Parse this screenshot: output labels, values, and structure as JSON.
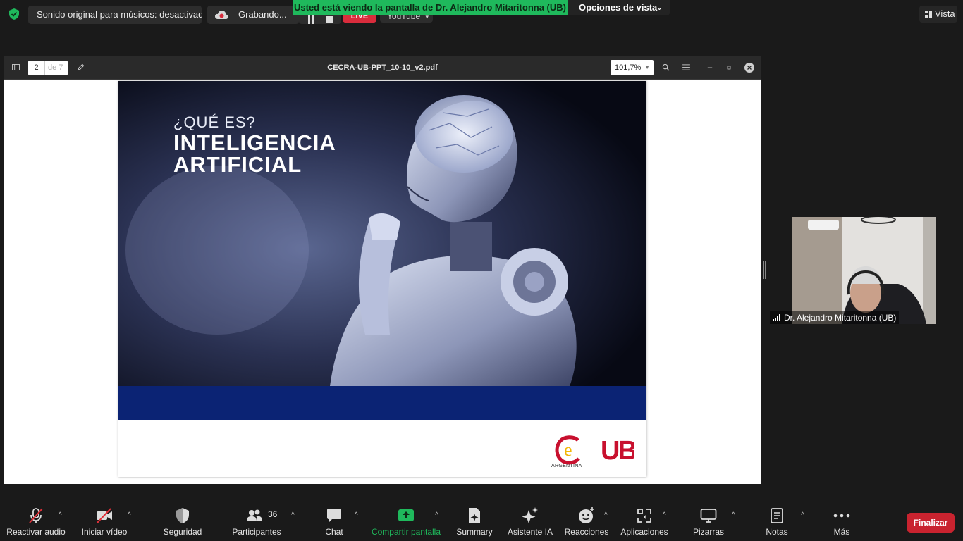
{
  "top_bar": {
    "original_sound": "Sonido original para músicos: desactivado",
    "recording": "Grabando...",
    "live_badge": "LIVE",
    "youtube": "YouTube",
    "share_banner": "Usted está viendo la pantalla de Dr. Alejandro Mitaritonna (UB)",
    "view_options": "Opciones de vista",
    "view_button": "Vista"
  },
  "pdf_viewer": {
    "filename": "CECRA-UB-PPT_10-10_v2.pdf",
    "current_page": "2",
    "total_pages": "de 7",
    "zoom": "101,7%"
  },
  "slide": {
    "subtitle": "¿QUÉ ES?",
    "title_line1": "INTELIGENCIA",
    "title_line2": "ARTIFICIAL",
    "logo_left_caption": "ARGENTINA",
    "logo_right_text": "UB"
  },
  "participant": {
    "name": "Dr. Alejandro Mitaritonna (UB)"
  },
  "toolbar": {
    "unmute": "Reactivar audio",
    "start_video": "Iniciar vídeo",
    "security": "Seguridad",
    "participants": "Participantes",
    "participants_count": "36",
    "chat": "Chat",
    "share_screen": "Compartir pantalla",
    "summary": "Summary",
    "ai_assistant": "Asistente IA",
    "reactions": "Reacciones",
    "apps": "Aplicaciones",
    "whiteboards": "Pizarras",
    "notes": "Notas",
    "more": "Más",
    "end": "Finalizar"
  },
  "colors": {
    "share_banner": "#1fb95c",
    "end_button": "#c9232f",
    "share_icon": "#1fb95c",
    "slide_band": "#0b2374"
  }
}
